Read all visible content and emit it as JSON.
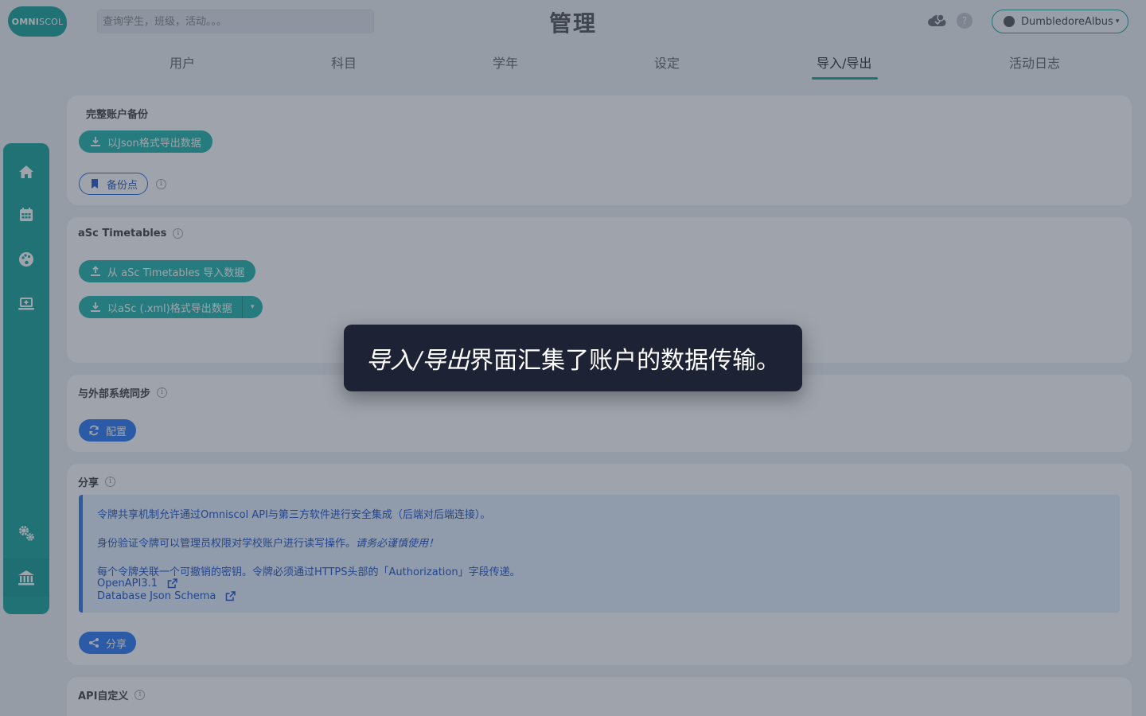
{
  "header": {
    "logo": {
      "bold": "OMNI",
      "light": "SCOL"
    },
    "search_placeholder": "查询学生，班级，活动。。。",
    "title": "管理",
    "help_icon_text": "?",
    "user_name": "DumbledoreAlbus",
    "user_caret": "▾"
  },
  "tabs": [
    {
      "label": "用户"
    },
    {
      "label": "科目"
    },
    {
      "label": "学年"
    },
    {
      "label": "设定"
    },
    {
      "label": "导入/导出",
      "active": true
    },
    {
      "label": "活动日志"
    }
  ],
  "sidebar": {
    "items": [
      "home-icon",
      "calendar-icon",
      "palette-icon",
      "laptop-add-icon",
      "cogs-icon",
      "institution-icon"
    ],
    "active_item": "institution-icon"
  },
  "info_symbol": "i",
  "sections": {
    "backup": {
      "title": "完整账户备份",
      "export_json_label": "以Json格式导出数据",
      "backup_point_label": "备份点"
    },
    "asc": {
      "title": "aSc Timetables",
      "import_label": "从 aSc Timetables 导入数据",
      "export_xml_label": "以aSc (.xml)格式导出数据",
      "dropdown_caret": "▾"
    },
    "sync": {
      "title": "与外部系统同步",
      "configure_label": "配置"
    },
    "share": {
      "title": "分享",
      "line1": "令牌共享机制允许通过Omniscol API与第三方软件进行安全集成（后端对后端连接）。",
      "line2": "身份验证令牌可以管理员权限对学校账户进行读写操作。",
      "line2_emphasis": "请务必谨慎使用！",
      "line3": "每个令牌关联一个可撤销的密钥。令牌必须通过HTTPS头部的「Authorization」字段传递。",
      "link1": "OpenAPI3.1",
      "link2": "Database Json Schema",
      "share_button": "分享"
    },
    "api": {
      "title": "API自定义"
    }
  },
  "tooltip": {
    "emphasis": "导入/导出",
    "text": "界面汇集了账户的数据传输。"
  },
  "colors": {
    "brand_teal": "#1aa69a",
    "button_teal": "#23b7a9",
    "button_blue": "#2e7cf6",
    "tooltip_bg": "#1e2235"
  }
}
